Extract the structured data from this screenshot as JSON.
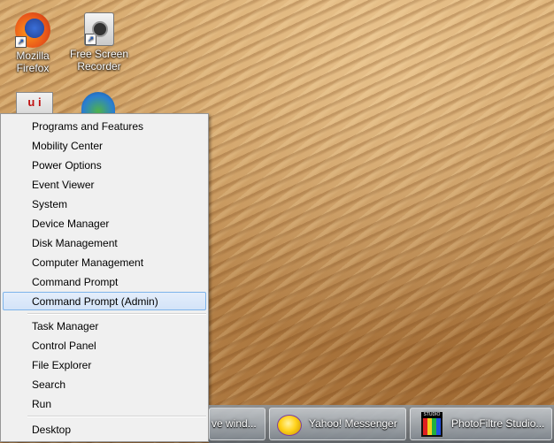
{
  "desktop_icons": [
    {
      "label_line1": "Mozilla",
      "label_line2": "Firefox",
      "icon": "firefox-icon"
    },
    {
      "label_line1": "Free Screen",
      "label_line2": "Recorder",
      "icon": "screen-recorder-icon"
    }
  ],
  "context_menu": {
    "items": [
      "Programs and Features",
      "Mobility Center",
      "Power Options",
      "Event Viewer",
      "System",
      "Device Manager",
      "Disk Management",
      "Computer Management",
      "Command Prompt",
      "Command Prompt (Admin)",
      "Task Manager",
      "Control Panel",
      "File Explorer",
      "Search",
      "Run",
      "Desktop"
    ],
    "highlighted": "Command Prompt (Admin)",
    "highlight_color": "#d3e3f8"
  },
  "taskbar": {
    "buttons": [
      {
        "label": "ve wind...",
        "icon": ""
      },
      {
        "label": "Yahoo! Messenger",
        "icon": "yahoo-messenger-icon"
      },
      {
        "label": "PhotoFiltre Studio...",
        "icon": "photofiltre-studio-icon"
      }
    ]
  }
}
